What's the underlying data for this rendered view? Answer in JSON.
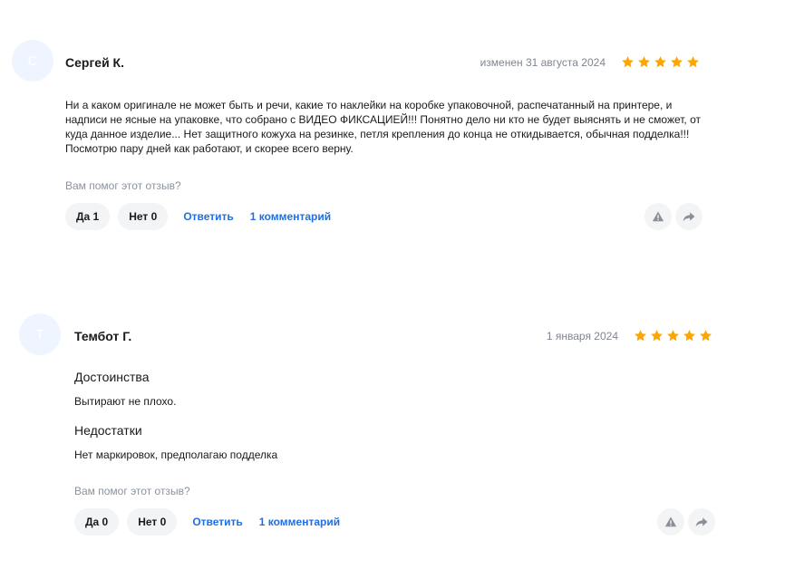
{
  "colors": {
    "star": "#ffa500",
    "link": "#1f6fe5",
    "muted": "#8a93a0",
    "pill_bg": "#f3f4f6"
  },
  "reviews": [
    {
      "avatar_letter": "С",
      "author": "Сергей К.",
      "date": "изменен 31 августа 2024",
      "rating": 5,
      "text": "Ни а каком оригинале не может быть и речи, какие то наклейки на коробке упаковочной, распечатанный на принтере, и надписи не ясные на упаковке, что собрано с ВИДЕО ФИКСАЦИЕЙ!!! Понятно дело ни кто не будет выяснять и не сможет, от куда данное изделие... Нет защитного кожуха на резинке, петля крепления до конца не откидывается, обычная подделка!!! Посмотрю пару дней как работают, и скорее всего верну.",
      "helpful_question": "Вам помог этот отзыв?",
      "yes_label": "Да 1",
      "no_label": "Нет 0",
      "reply_label": "Ответить",
      "comments_label": "1 комментарий",
      "icons": [
        "warning-icon",
        "share-arrow-icon"
      ]
    },
    {
      "avatar_letter": "Т",
      "author": "Тембот Г.",
      "date": "1 января 2024",
      "rating": 5,
      "pros_title": "Достоинства",
      "pros_text": "Вытирают не плохо.",
      "cons_title": "Недостатки",
      "cons_text": "Нет маркировок, предполагаю подделка",
      "helpful_question": "Вам помог этот отзыв?",
      "yes_label": "Да 0",
      "no_label": "Нет 0",
      "reply_label": "Ответить",
      "comments_label": "1 комментарий",
      "icons": [
        "warning-icon",
        "share-arrow-icon"
      ]
    }
  ]
}
